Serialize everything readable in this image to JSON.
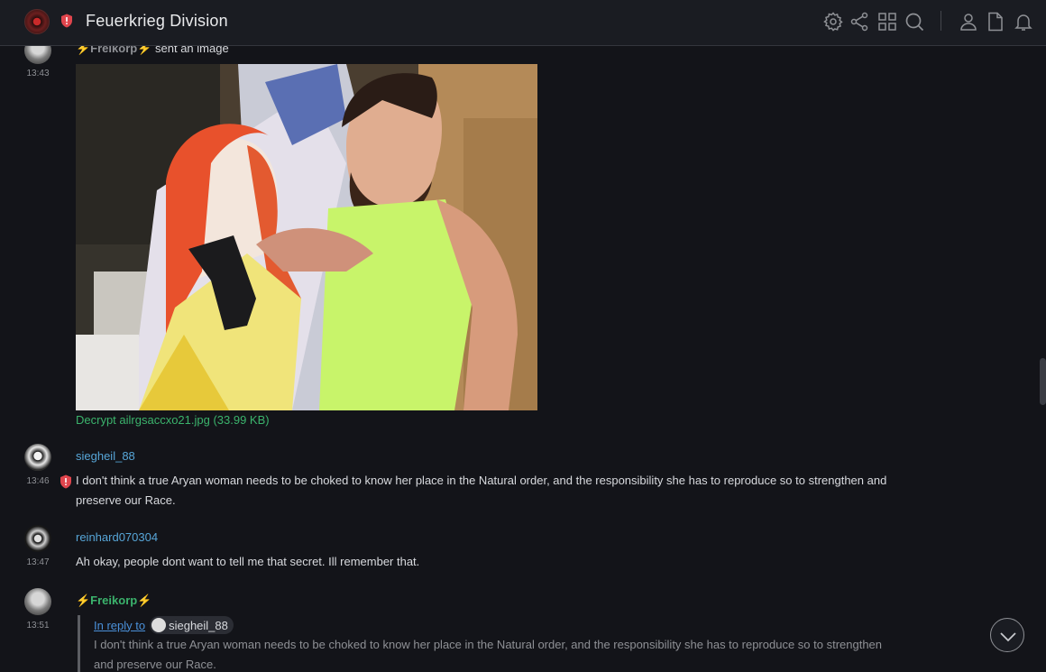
{
  "header": {
    "room_name": "Feuerkrieg Division",
    "icons": [
      "room-avatar",
      "shield-icon",
      "settings-icon",
      "share-icon",
      "apps-icon",
      "search-icon",
      "members-icon",
      "files-icon",
      "notifications-icon"
    ]
  },
  "colors": {
    "background": "#131419",
    "header": "#1a1c22",
    "sender_blue": "#57a6d8",
    "sender_green": "#3bb36c",
    "link_green": "#3bb36c",
    "shield_red": "#e0454d"
  },
  "messages": [
    {
      "time": "13:43",
      "sender": "⚡Freikorp⚡",
      "action": "sent an image",
      "file_link": "Decrypt ailrgsaccxo21.jpg (33.99 KB)"
    },
    {
      "time": "13:46",
      "sender": "siegheil_88",
      "text": "I don't think a true Aryan woman needs to be choked to know her place in the Natural order, and the responsibility she has to reproduce so to strengthen and preserve our Race."
    },
    {
      "time": "13:47",
      "sender": "reinhard070304",
      "text": "Ah okay, people dont want to tell me that secret. Ill remember that."
    },
    {
      "time": "13:51",
      "sender": "⚡Freikorp⚡",
      "reply": {
        "label": "In reply to",
        "user": "siegheil_88",
        "quote": "I don't think a true Aryan woman needs to be choked to know her place in the Natural order, and the responsibility she has to reproduce so to strengthen and preserve our Race."
      }
    }
  ]
}
